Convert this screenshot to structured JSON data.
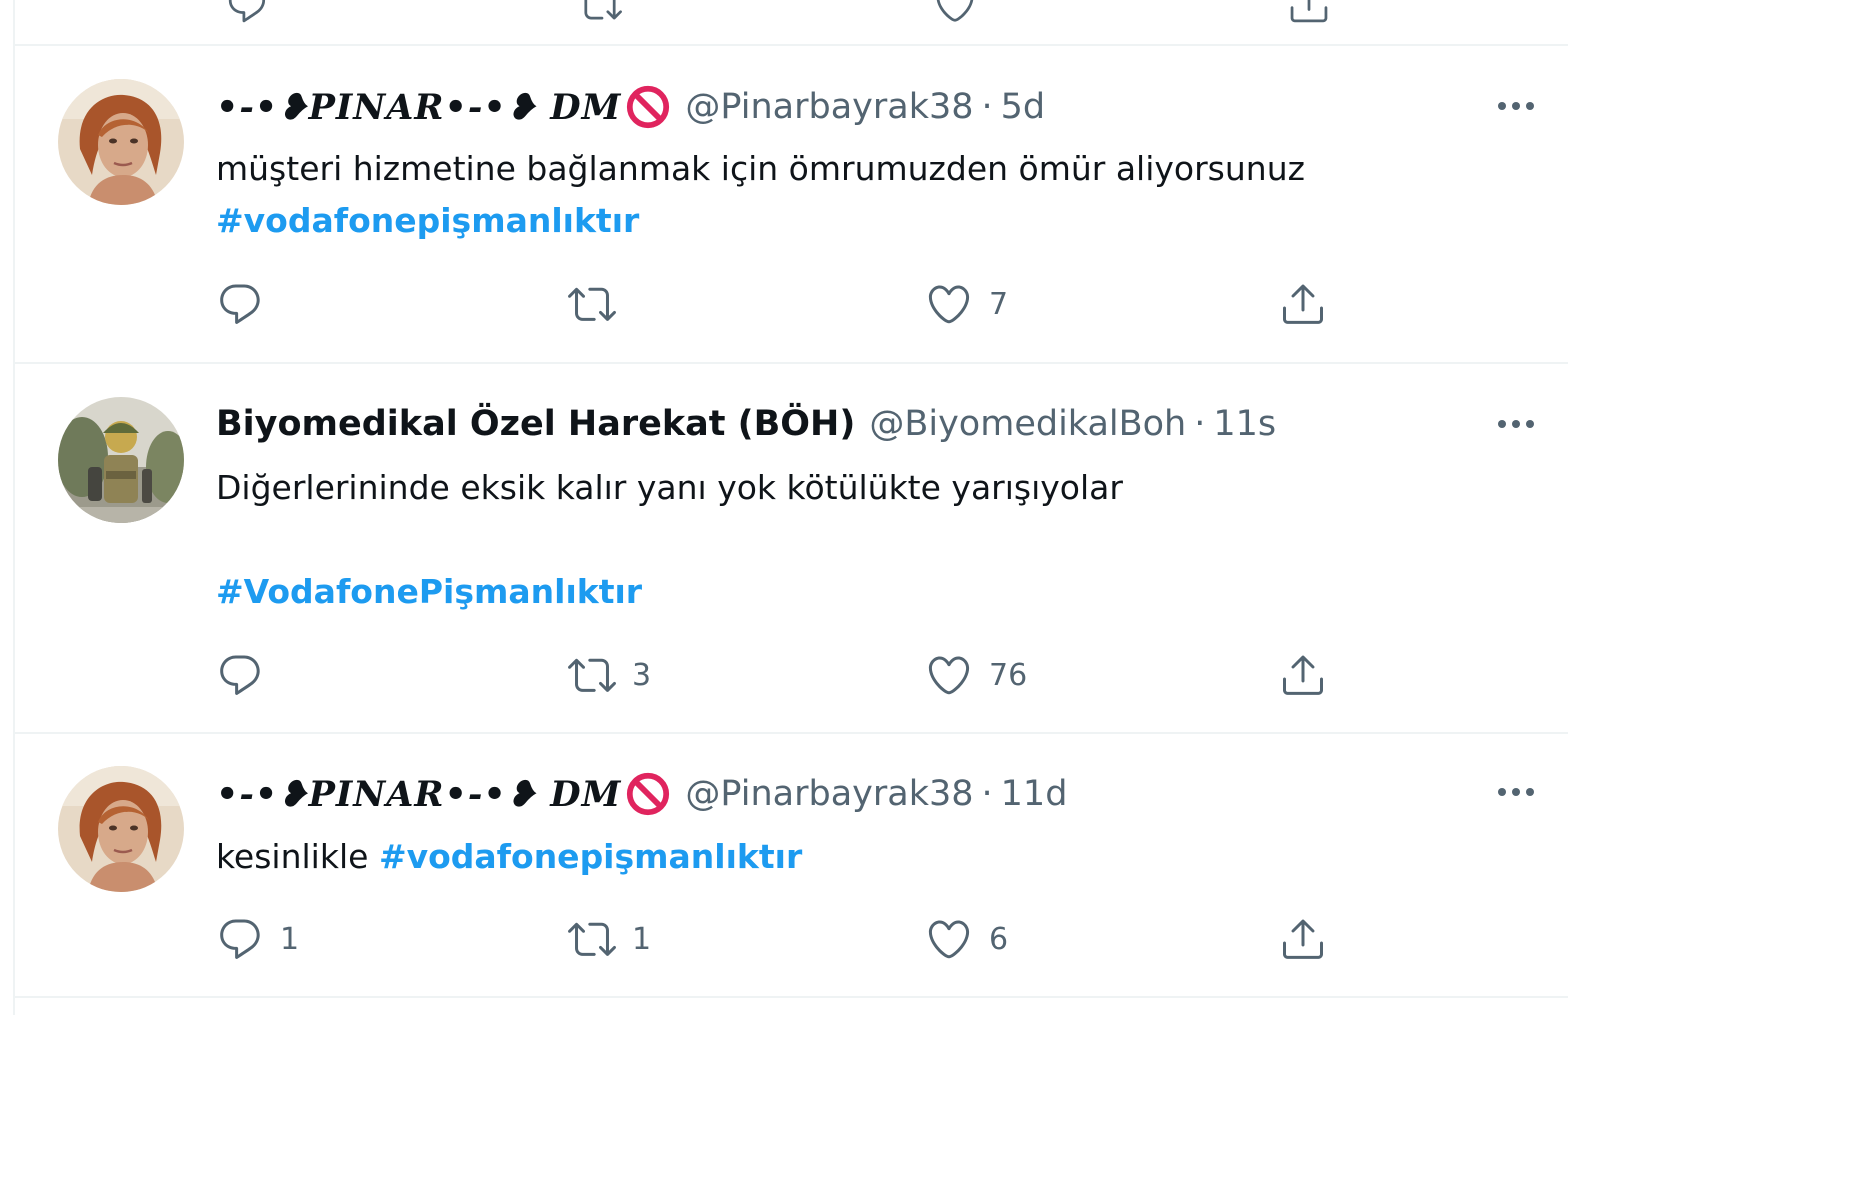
{
  "colors": {
    "link": "#1d9bf0",
    "text": "#0f1419",
    "muted": "#536471",
    "border": "#eff3f4"
  },
  "icons": {
    "reply": "speech-bubble",
    "retweet": "two-arrows-loop",
    "like": "heart-outline",
    "share": "upload-arrow",
    "more": "three-dots",
    "no_entry": "prohibited-sign"
  },
  "tweets": [
    {
      "display_name": "•-•❥PINAR•-•❥ DM",
      "handle": "@Pinarbayrak38",
      "separator": "·",
      "time": "5d",
      "text_line1": "müşteri hizmetine bağlanmak için ömrumuzden ömür aliyorsunuz",
      "hashtag": "#vodafonepişmanlıktır",
      "reply_count": "",
      "retweet_count": "",
      "like_count": "7"
    },
    {
      "display_name": "Biyomedikal Özel Harekat (BÖH)",
      "handle": "@BiyomedikalBoh",
      "separator": "·",
      "time": "11s",
      "text_line1": "Diğerlerininde eksik kalır yanı yok kötülükte yarışıyolar",
      "hashtag": "#VodafonePişmanlıktır",
      "reply_count": "",
      "retweet_count": "3",
      "like_count": "76"
    },
    {
      "display_name": "•-•❥PINAR•-•❥ DM",
      "handle": "@Pinarbayrak38",
      "separator": "·",
      "time": "11d",
      "text_line1": "kesinlikle",
      "hashtag": "#vodafonepişmanlıktır",
      "reply_count": "1",
      "retweet_count": "1",
      "like_count": "6"
    }
  ]
}
